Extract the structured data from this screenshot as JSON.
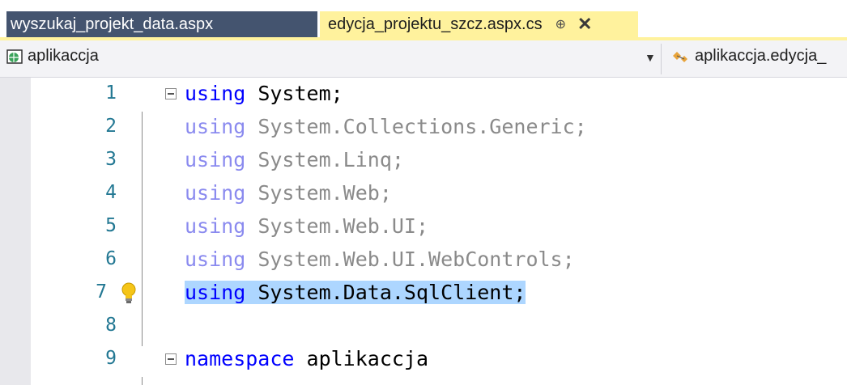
{
  "tabs": [
    {
      "label": "wyszukaj_projekt_data.aspx",
      "active": false
    },
    {
      "label": "edycja_projektu_szcz.aspx.cs",
      "active": true
    }
  ],
  "tab_pin_glyph": "⊕",
  "tab_close_glyph": "✕",
  "navbar": {
    "project": "aplikaccja",
    "type": "aplikaccja.edycja_"
  },
  "code_lines": [
    {
      "number": "1",
      "keyword": "using",
      "rest": " System;"
    },
    {
      "number": "2",
      "keyword": "using",
      "rest": " System.Collections.Generic;"
    },
    {
      "number": "3",
      "keyword": "using",
      "rest": " System.Linq;"
    },
    {
      "number": "4",
      "keyword": "using",
      "rest": " System.Web;"
    },
    {
      "number": "5",
      "keyword": "using",
      "rest": " System.Web.UI;"
    },
    {
      "number": "6",
      "keyword": "using",
      "rest": " System.Web.UI.WebControls;"
    },
    {
      "number": "7",
      "keyword": "using",
      "rest": " System.Data.SqlClient;"
    },
    {
      "number": "8",
      "keyword": "",
      "rest": ""
    },
    {
      "number": "9",
      "keyword": "namespace",
      "rest": " aplikaccja"
    }
  ],
  "colors": {
    "active_tab": "#fff29d",
    "inactive_tab": "#44546f",
    "keyword": "#0000ff",
    "selection": "#add6ff",
    "line_number": "#237893"
  },
  "icons": {
    "project": "csharp-project-icon",
    "type": "class-icon",
    "lightbulb": "lightbulb-icon"
  }
}
